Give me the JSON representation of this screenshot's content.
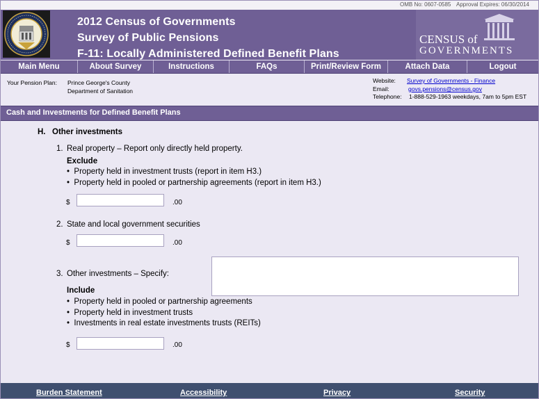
{
  "omb": {
    "number": "OMB No:  0607-0585",
    "expires": "Approval Expires:  06/30/2014"
  },
  "header": {
    "title_line1": "2012 Census of Governments",
    "title_line2": "Survey of Public Pensions",
    "title_line3": "F-11:  Locally Administered Defined Benefit Plans",
    "logo_line1": "CENSUS of",
    "logo_line2": "GOVERNMENTS"
  },
  "nav": {
    "items": [
      "Main Menu",
      "About Survey",
      "Instructions",
      "FAQs",
      "Print/Review Form",
      "Attach Data",
      "Logout"
    ]
  },
  "info": {
    "plan_label": "Your Pension Plan:",
    "plan_name_line1": "Prince George's County",
    "plan_name_line2": "Department of Sanitation",
    "website_label": "Website:",
    "website_link": "Survey of Governments - Finance",
    "email_label": "Email:",
    "email_link": "govs.pensions@census.gov",
    "telephone_label": "Telephone:",
    "telephone_value": "1-888-529-1963  weekdays, 7am to 5pm EST"
  },
  "section": {
    "title": "Cash and Investments for Defined Benefit Plans"
  },
  "form": {
    "heading_letter": "H.",
    "heading_text": "Other investments",
    "q1": {
      "number": "1.",
      "text": "Real property – Report only directly held property.",
      "exclude_label": "Exclude",
      "bullets": [
        "Property held in investment trusts (report in item H3.)",
        "Property held in pooled or partnership agreements (report in item H3.)"
      ],
      "currency": "$",
      "cents": ".00",
      "value": ""
    },
    "q2": {
      "number": "2.",
      "text": "State and local government securities",
      "currency": "$",
      "cents": ".00",
      "value": ""
    },
    "q3": {
      "number": "3.",
      "text": "Other investments – Specify:",
      "include_label": "Include",
      "bullets": [
        "Property held in pooled or partnership agreements",
        "Property held in investment trusts",
        "Investments in real estate investments trusts (REITs)"
      ],
      "currency": "$",
      "cents": ".00",
      "value": "",
      "specify": ""
    }
  },
  "footer": {
    "links": [
      "Burden Statement",
      "Accessibility",
      "Privacy",
      "Security"
    ]
  },
  "colors": {
    "header_purple": "#6f5f95",
    "page_background": "#ebe8f3",
    "footer_blue": "#3f4f6f",
    "link_blue": "#0000cc"
  }
}
